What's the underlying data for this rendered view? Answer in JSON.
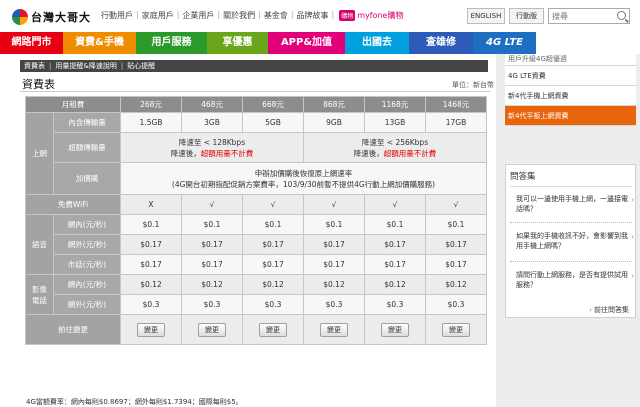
{
  "top": {
    "logo_text": "台灣大哥大",
    "links": [
      "行動用戶",
      "家庭用戶",
      "企業用戶",
      "關於我們",
      "基金會",
      "品牌故事"
    ],
    "myfone_badge": "購物",
    "myfone_text": "myfone購物",
    "english": "ENGLISH",
    "mobile": "行動版",
    "search_placeholder": "搜尋"
  },
  "nav": [
    {
      "label": "網路門市",
      "color": "#e60012"
    },
    {
      "label": "資費&手機",
      "color": "#f08c00"
    },
    {
      "label": "用戶服務",
      "color": "#2b9a2b"
    },
    {
      "label": "享優惠",
      "color": "#6aa51a"
    },
    {
      "label": "APP&加值",
      "color": "#e2007a"
    },
    {
      "label": "出國去",
      "color": "#00a0e0"
    },
    {
      "label": "查雄修",
      "color": "#2d5cb8"
    }
  ],
  "nav_4g": "4G LTE",
  "subnav": [
    "資費表",
    "用量提醒&降速說明",
    "貼心提醒"
  ],
  "page_title": "資費表",
  "unit": "單位：新台幣",
  "table": {
    "monthly_fee_label": "月租費",
    "plans": [
      "268元",
      "468元",
      "668元",
      "868元",
      "1168元",
      "1468元"
    ],
    "internet_label": "上網",
    "included_label": "內含傳輸量",
    "included": [
      "1.5GB",
      "3GB",
      "5GB",
      "9GB",
      "13GB",
      "17GB"
    ],
    "excess_label": "超額傳輸量",
    "excess_a_line1": "降速至 < 128Kbps",
    "excess_a_line2_prefix": "降速後，",
    "excess_a_line2_red": "超額用量不計費",
    "excess_b_line1": "降速至 < 256Kbps",
    "excess_b_line2_prefix": "降速後，",
    "excess_b_line2_red": "超額用量不計費",
    "addon_label": "加價購",
    "addon_line1": "申辦加價購後恢復原上網速率",
    "addon_line2": "(4G開台初期指配促銷方案費率，103/9/30前暫不提供4G行動上網加價購服務)",
    "wifi_label": "免費WiFi",
    "wifi": [
      "X",
      "√",
      "√",
      "√",
      "√",
      "√"
    ],
    "voice_label": "語音",
    "onnet_label": "網內(元/秒)",
    "onnet": [
      "$0.1",
      "$0.1",
      "$0.1",
      "$0.1",
      "$0.1",
      "$0.1"
    ],
    "offnet_label": "網外(元/秒)",
    "offnet": [
      "$0.17",
      "$0.17",
      "$0.17",
      "$0.17",
      "$0.17",
      "$0.17"
    ],
    "landline_label": "市話(元/秒)",
    "landline": [
      "$0.17",
      "$0.17",
      "$0.17",
      "$0.17",
      "$0.17",
      "$0.17"
    ],
    "video_label_1": "影像",
    "video_label_2": "電話",
    "video_onnet_label": "網內(元/秒)",
    "video_onnet": [
      "$0.12",
      "$0.12",
      "$0.12",
      "$0.12",
      "$0.12",
      "$0.12"
    ],
    "video_offnet_label": "網外(元/秒)",
    "video_offnet": [
      "$0.3",
      "$0.3",
      "$0.3",
      "$0.3",
      "$0.3",
      "$0.3"
    ],
    "change_label": "前往變更",
    "change_button": "變更"
  },
  "footnote": "4G當額費率：網內每則$0.8697；網外每則$1.7394；國際每則$5。",
  "side": {
    "items": [
      "用戶升級4G超優週",
      "4G LTE資費",
      "新4代手機上網資費",
      "新4代平板上網資費"
    ],
    "active_index": 3,
    "qa_title": "問答集",
    "qa": [
      "我可以一邊使用手機上網，一邊接電話嗎？",
      "如果我的手機收訊不好，會影響到我用手機上網嗎？",
      "請問行動上網服務，是否有提供試用服務？"
    ],
    "qa_more": "前往問答集"
  }
}
